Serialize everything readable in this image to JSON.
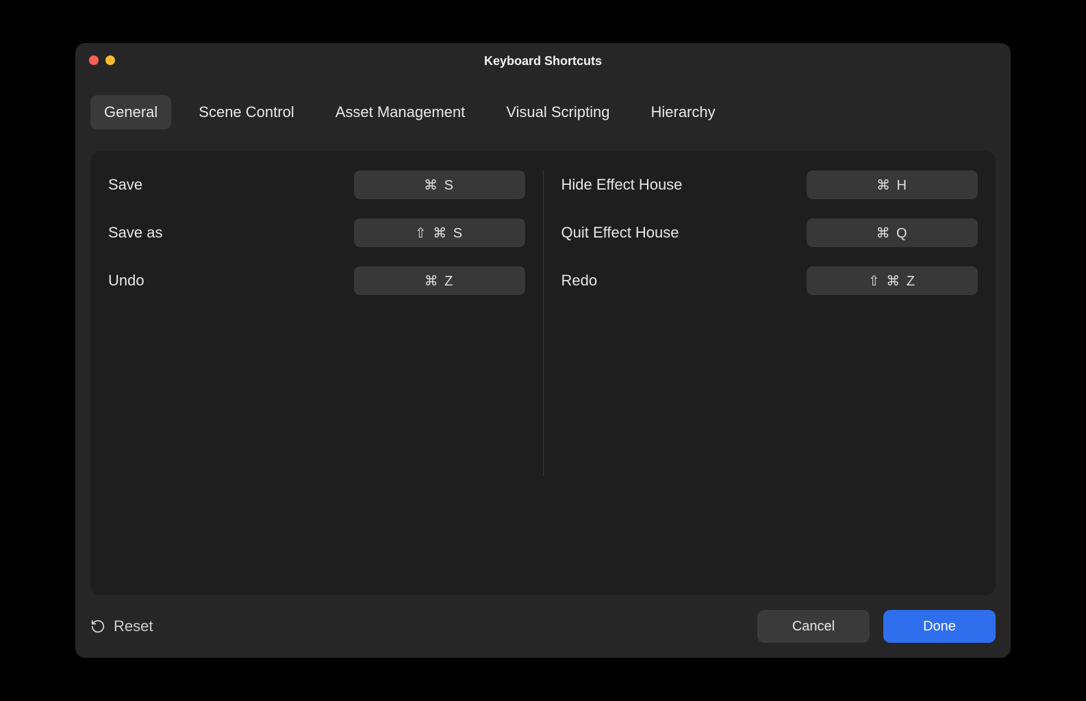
{
  "window": {
    "title": "Keyboard Shortcuts"
  },
  "tabs": {
    "general": "General",
    "scene_control": "Scene Control",
    "asset_management": "Asset Management",
    "visual_scripting": "Visual Scripting",
    "hierarchy": "Hierarchy",
    "active": "general"
  },
  "shortcuts": {
    "left": [
      {
        "label": "Save",
        "keys": "⌘ S"
      },
      {
        "label": "Save as",
        "keys": "⇧ ⌘ S"
      },
      {
        "label": "Undo",
        "keys": "⌘ Z"
      }
    ],
    "right": [
      {
        "label": "Hide Effect House",
        "keys": "⌘ H"
      },
      {
        "label": "Quit Effect House",
        "keys": "⌘ Q"
      },
      {
        "label": "Redo",
        "keys": "⇧ ⌘ Z"
      }
    ]
  },
  "footer": {
    "reset": "Reset",
    "cancel": "Cancel",
    "done": "Done"
  }
}
